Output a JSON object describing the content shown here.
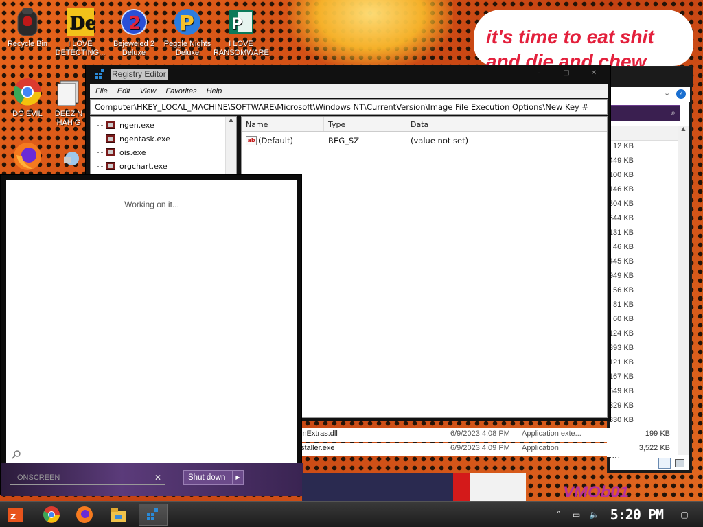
{
  "wallpaper": {
    "speech_lines": [
      "it's time to eat shit",
      "and die and chew"
    ],
    "watermark": "VMOb01"
  },
  "desktop_icons": [
    {
      "label": "Recycle Bin",
      "icon": "recycle-bin-icon"
    },
    {
      "label": "I LOVE\nDETECTING...",
      "icon": "detect-it-easy-icon"
    },
    {
      "label": "Bejeweled 2\nDeluxe",
      "icon": "bejeweled-icon"
    },
    {
      "label": "Peggle Nights\nDeluxe",
      "icon": "peggle-icon"
    },
    {
      "label": "I LOVE\nRANSOMWARE",
      "icon": "publisher-icon"
    },
    {
      "label": "DO EVIL",
      "icon": "chrome-icon"
    },
    {
      "label": "DEEZ N\nHAH G",
      "icon": "document-icon"
    },
    {
      "label": "",
      "icon": "firefox-icon"
    },
    {
      "label": "",
      "icon": "network-icon"
    }
  ],
  "registry_editor": {
    "title": "Registry Editor",
    "window_buttons": [
      "–",
      "□",
      "✕"
    ],
    "menu": [
      "File",
      "Edit",
      "View",
      "Favorites",
      "Help"
    ],
    "address": "Computer\\HKEY_LOCAL_MACHINE\\SOFTWARE\\Microsoft\\Windows NT\\CurrentVersion\\Image File Execution Options\\New Key #",
    "tree_items": [
      "ngen.exe",
      "ngentask.exe",
      "ois.exe",
      "orgchart.exe"
    ],
    "columns": [
      "Name",
      "Type",
      "Data"
    ],
    "values": [
      {
        "name": "(Default)",
        "type": "REG_SZ",
        "data": "(value not set)",
        "icon": "string-value-icon"
      }
    ]
  },
  "explorer": {
    "sizes": [
      "12 KB",
      "449 KB",
      "100 KB",
      "146 KB",
      "304 KB",
      "544 KB",
      "131 KB",
      "46 KB",
      "445 KB",
      "949 KB",
      "56 KB",
      "81 KB",
      "60 KB",
      "124 KB",
      "393 KB",
      "121 KB",
      "167 KB",
      "549 KB",
      "329 KB",
      "330 KB"
    ],
    "visible_rows": [
      {
        "name": "inExtras.dll",
        "date": "6/9/2023 4:08 PM",
        "type": "Application exte...",
        "size": "199 KB"
      },
      {
        "name": "staller.exe",
        "date": "6/9/2023 4:09 PM",
        "type": "Application",
        "size": "3,522 KB"
      }
    ]
  },
  "start_menu": {
    "status": "Working on it...",
    "search_value": "ONSCREEN",
    "shutdown_label": "Shut down"
  },
  "taskbar": {
    "items": [
      "start-button",
      "chrome-icon",
      "firefox-icon",
      "explorer-icon",
      "regedit-icon"
    ],
    "clock": "5:20 PM"
  },
  "colors": {
    "wallpaper_orange": "#c84a10",
    "speech_red": "#e3203c",
    "start_purple": "#5b3b7a",
    "watermark_magenta": "#b6309e"
  }
}
